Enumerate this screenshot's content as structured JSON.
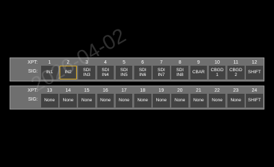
{
  "watermark": "2026-04-02",
  "labels": {
    "xpt": "XPT:",
    "sig": "SIG:"
  },
  "colors": {
    "selection": "#d8a71e",
    "panel": "#6f6f6f",
    "cell": "#424242"
  },
  "rows": [
    {
      "cells": [
        {
          "xpt": "1",
          "sig": "IN1"
        },
        {
          "xpt": "2",
          "sig": "IN2",
          "selected": true
        },
        {
          "xpt": "3",
          "sig": "SDI\nIN3"
        },
        {
          "xpt": "4",
          "sig": "SDI\nIN4"
        },
        {
          "xpt": "5",
          "sig": "SDI\nIN5"
        },
        {
          "xpt": "6",
          "sig": "SDI\nIN6"
        },
        {
          "xpt": "7",
          "sig": "SDI\nIN7"
        },
        {
          "xpt": "8",
          "sig": "SDI\nIN8"
        },
        {
          "xpt": "9",
          "sig": "CBAR"
        },
        {
          "xpt": "10",
          "sig": "CBGD\n1"
        },
        {
          "xpt": "11",
          "sig": "CBGD\n2"
        },
        {
          "xpt": "12",
          "sig": "SHIFT"
        }
      ]
    },
    {
      "cells": [
        {
          "xpt": "13",
          "sig": "None"
        },
        {
          "xpt": "14",
          "sig": "None"
        },
        {
          "xpt": "15",
          "sig": "None"
        },
        {
          "xpt": "16",
          "sig": "None"
        },
        {
          "xpt": "17",
          "sig": "None"
        },
        {
          "xpt": "18",
          "sig": "None"
        },
        {
          "xpt": "19",
          "sig": "None"
        },
        {
          "xpt": "20",
          "sig": "None"
        },
        {
          "xpt": "21",
          "sig": "None"
        },
        {
          "xpt": "22",
          "sig": "None"
        },
        {
          "xpt": "23",
          "sig": "None"
        },
        {
          "xpt": "24",
          "sig": "SHIFT"
        }
      ]
    }
  ]
}
